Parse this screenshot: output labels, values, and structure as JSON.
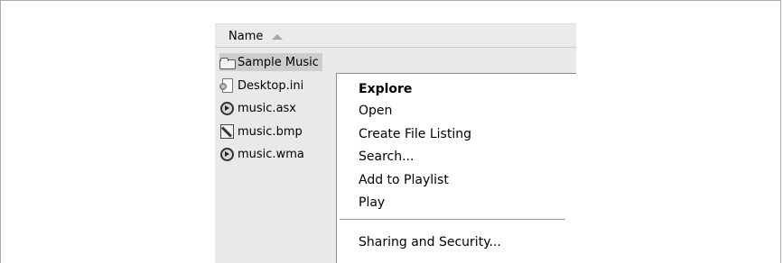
{
  "file_list": {
    "column_header": "Name",
    "items": [
      {
        "name": "Sample Music",
        "icon": "folder-icon",
        "selected": true
      },
      {
        "name": "Desktop.ini",
        "icon": "settings-file-icon",
        "selected": false
      },
      {
        "name": "music.asx",
        "icon": "media-file-icon",
        "selected": false
      },
      {
        "name": "music.bmp",
        "icon": "bitmap-file-icon",
        "selected": false
      },
      {
        "name": "music.wma",
        "icon": "media-file-icon",
        "selected": false
      }
    ]
  },
  "context_menu": {
    "items": [
      {
        "label": "Explore",
        "default": true
      },
      {
        "label": "Open"
      },
      {
        "label": "Create File Listing"
      },
      {
        "label": "Search..."
      },
      {
        "label": "Add to Playlist"
      },
      {
        "label": "Play"
      },
      {
        "label": "Sharing and Security..."
      }
    ]
  }
}
